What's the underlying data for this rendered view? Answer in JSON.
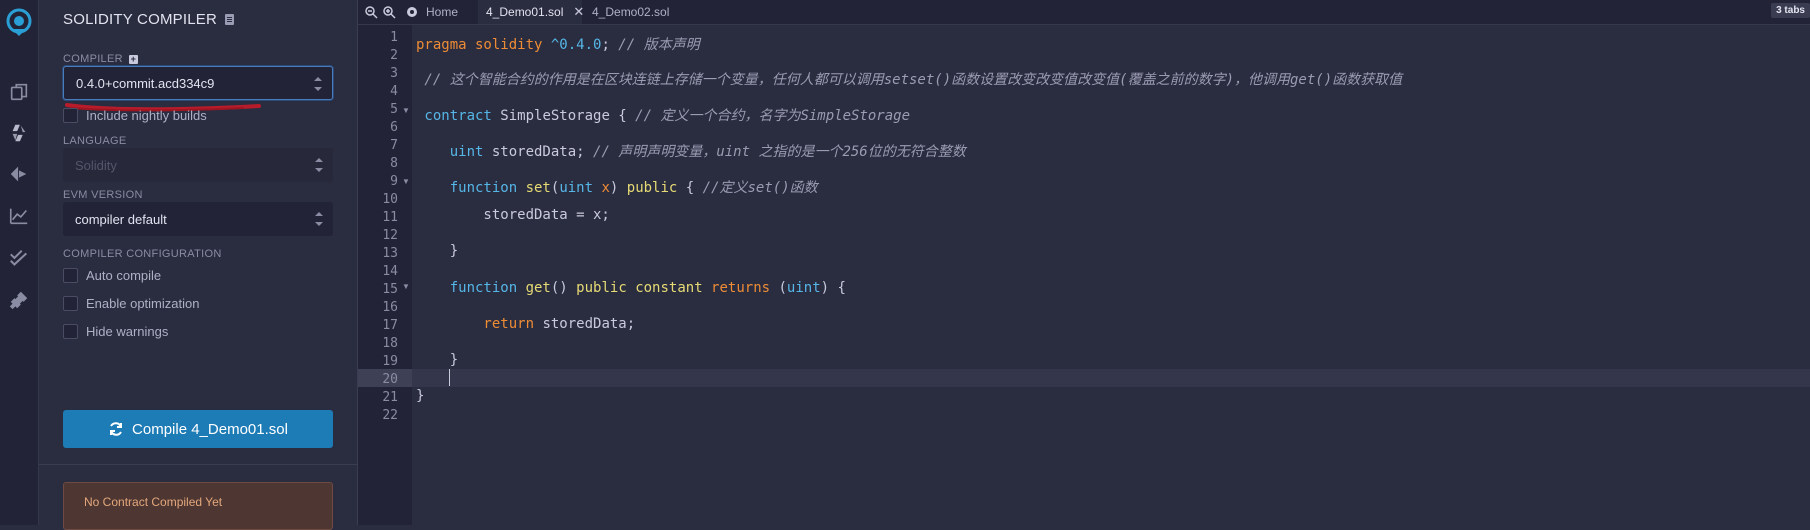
{
  "panel": {
    "title": "SOLIDITY COMPILER",
    "compiler_label": "COMPILER",
    "compiler_value": "0.4.0+commit.acd334c9",
    "nightly_label": "Include nightly builds",
    "language_label": "LANGUAGE",
    "language_value": "Solidity",
    "evm_label": "EVM VERSION",
    "evm_value": "compiler default",
    "config_label": "COMPILER CONFIGURATION",
    "auto_compile": "Auto compile",
    "enable_opt": "Enable optimization",
    "hide_warnings": "Hide warnings",
    "compile_button": "Compile 4_Demo01.sol",
    "no_contract": "No Contract Compiled Yet"
  },
  "tabs": {
    "home": "Home",
    "file1": "4_Demo01.sol",
    "file2": "4_Demo02.sol",
    "count": "3 tabs"
  },
  "line_numbers": [
    "1",
    "2",
    "3",
    "4",
    "5",
    "6",
    "7",
    "8",
    "9",
    "10",
    "11",
    "12",
    "13",
    "14",
    "15",
    "16",
    "17",
    "18",
    "19",
    "20",
    "21",
    "22"
  ],
  "code": {
    "l1_a": "pragma solidity ",
    "l1_b": "^0.4.0",
    "l1_c": "; ",
    "l1_cm": "// 版本声明",
    "l3_cm": " // 这个智能合约的作用是在区块连链上存储一个变量，任何人都可以调用setset()函数设置改变改变值改变值(覆盖之前的数字)，他调用get()函数获取值",
    "l5_a": " contract ",
    "l5_b": "SimpleStorage { ",
    "l5_cm": "// 定义一个合约，名字为SimpleStorage",
    "l7_a": "    uint ",
    "l7_b": "storedData; ",
    "l7_cm": "// 声明声明变量，uint 之指的是一个256位的无符合整数",
    "l9_a": "    function ",
    "l9_b": "set",
    "l9_c": "(",
    "l9_d": "uint ",
    "l9_e": "x",
    "l9_f": ") ",
    "l9_g": "public",
    "l9_h": " { ",
    "l9_cm": "//定义set()函数",
    "l11": "        storedData = x;",
    "l13": "    }",
    "l15_a": "    function ",
    "l15_b": "get",
    "l15_c": "() ",
    "l15_d": "public ",
    "l15_e": "constant ",
    "l15_f": "returns",
    "l15_g": " (",
    "l15_h": "uint",
    "l15_i": ") {",
    "l17_a": "        return ",
    "l17_b": "storedData;",
    "l19": "    }",
    "l21": "}"
  }
}
